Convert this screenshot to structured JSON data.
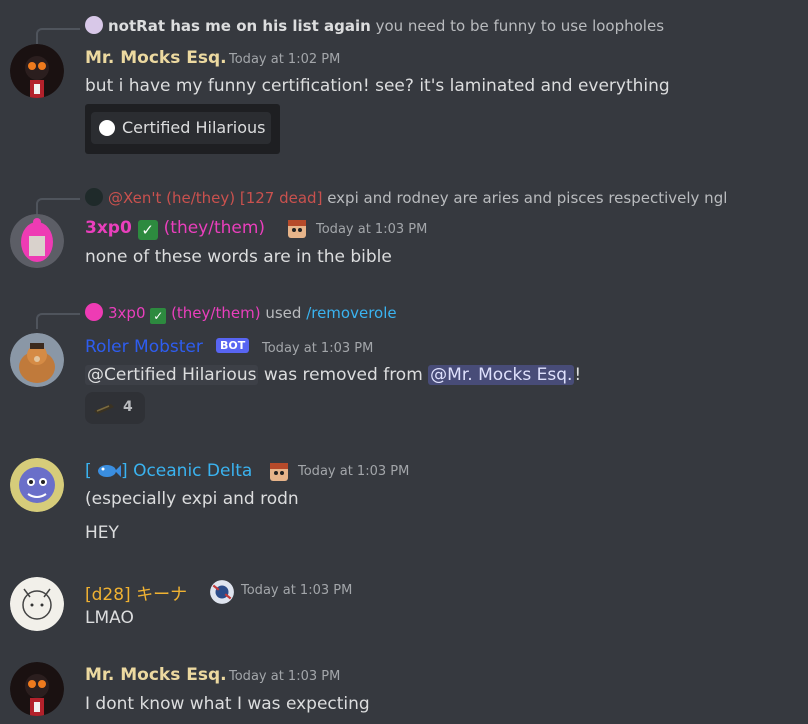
{
  "messages": {
    "m1": {
      "reply": {
        "author": "notRat has me on his list again",
        "text": "you need to be funny to use loopholes"
      },
      "author": "Mr. Mocks Esq.",
      "timestamp": "Today at 1:02 PM",
      "text": "but i have my funny certification! see? it's laminated and everything",
      "attachment_label": "Certified Hilarious"
    },
    "m2": {
      "reply": {
        "author": "@Xen't (he/they) [127 dead]",
        "text": "expi and rodney are aries and pisces respectively ngl"
      },
      "author_name": "3xp0",
      "author_pronouns": "(they/them)",
      "timestamp": "Today at 1:03 PM",
      "text": "none of these words are in the bible"
    },
    "m3": {
      "command": {
        "user": "3xp0",
        "pronouns": "(they/them)",
        "used": "used",
        "command": "/removerole"
      },
      "author": "Roler Mobster",
      "bot_tag": "BOT",
      "timestamp": "Today at 1:03 PM",
      "mention_role": "@Certified Hilarious",
      "text_middle": " was removed from ",
      "mention_user": "@Mr. Mocks Esq.",
      "text_end": "!",
      "reaction_count": "4"
    },
    "m4": {
      "author_prefix": "[",
      "author_suffix": "] Oceanic Delta",
      "timestamp": "Today at 1:03 PM",
      "lines": [
        "(especially expi and rodn",
        "HEY"
      ]
    },
    "m5": {
      "author": "[d28] キーナ",
      "timestamp": "Today at 1:03 PM",
      "text": "LMAO"
    },
    "m6": {
      "author": "Mr. Mocks Esq.",
      "timestamp": "Today at 1:03 PM",
      "text": "I dont know what I was expecting"
    }
  },
  "colors": {
    "background": "#36393f",
    "mr_mocks": "#ecd9a0",
    "pink": "#ea3fbd",
    "bot_blue": "#2e5df0",
    "oceanic": "#3ab3f0",
    "gold": "#f0b232",
    "xen_red": "#c9514e"
  }
}
